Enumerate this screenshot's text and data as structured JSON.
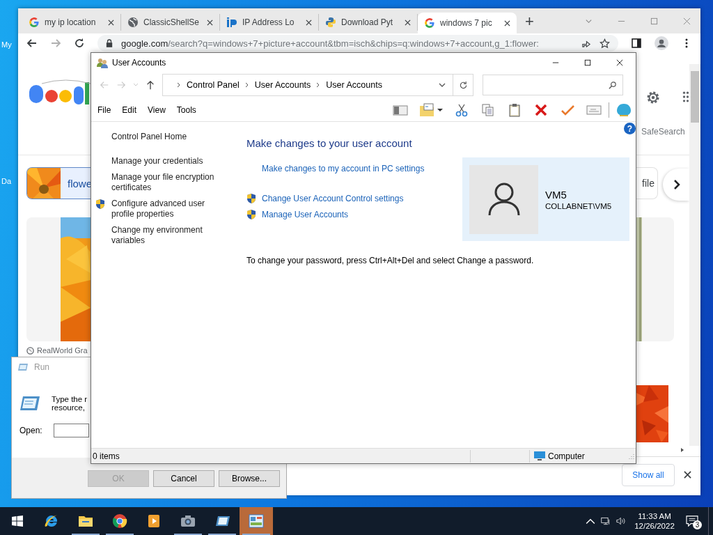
{
  "desktop": {
    "icon_labels": [
      "My",
      "Da"
    ]
  },
  "browser": {
    "tabs": [
      {
        "title": "my ip location",
        "selected": false
      },
      {
        "title": "ClassicShellSe",
        "selected": false
      },
      {
        "title": "IP Address Lo",
        "selected": false
      },
      {
        "title": "Download Pyt",
        "selected": false
      },
      {
        "title": "windows 7 pic",
        "selected": true
      }
    ],
    "new_tab": "+",
    "url_host": "google.com",
    "url_path": "/search?q=windows+7+picture+account&tbm=isch&chips=q:windows+7+account,g_1:flower:",
    "chip_left": "flowe",
    "chip_right": "file",
    "safesearch": "SafeSearch",
    "image_caption": "RealWorld Gra",
    "show_all": "Show all"
  },
  "run_dialog": {
    "title": "Run",
    "description_lines": [
      "Type the r",
      "resource,"
    ],
    "open_label": "Open:",
    "buttons": [
      {
        "label": "OK",
        "disabled": true
      },
      {
        "label": "Cancel",
        "disabled": false
      },
      {
        "label": "Browse...",
        "disabled": false
      }
    ]
  },
  "user_accounts": {
    "title": "User Accounts",
    "breadcrumb": [
      "Control Panel",
      "User Accounts",
      "User Accounts"
    ],
    "menu": [
      "File",
      "Edit",
      "View",
      "Tools"
    ],
    "help": "?",
    "sidebar": [
      {
        "label": "Control Panel Home",
        "shield": false
      },
      {
        "label": "Manage your credentials",
        "shield": false
      },
      {
        "label": "Manage your file encryption certificates",
        "shield": false
      },
      {
        "label": "Configure advanced user profile properties",
        "shield": true
      },
      {
        "label": "Change my environment variables",
        "shield": false
      }
    ],
    "heading": "Make changes to your user account",
    "links": [
      {
        "label": "Make changes to my account in PC settings",
        "shield": false
      },
      {
        "label": "Change User Account Control settings",
        "shield": true
      },
      {
        "label": "Manage User Accounts",
        "shield": true
      }
    ],
    "account": {
      "name": "VM5",
      "domain": "COLLABNET\\VM5"
    },
    "password_note": "To change your password, press Ctrl+Alt+Del and select Change a password.",
    "status": {
      "items": "0 items",
      "location": "Computer"
    }
  },
  "taskbar": {
    "apps": [
      {
        "kind": "ie",
        "running": false,
        "selected": false
      },
      {
        "kind": "folder",
        "running": true,
        "selected": false
      },
      {
        "kind": "chrome",
        "running": true,
        "selected": false
      },
      {
        "kind": "media",
        "running": false,
        "selected": false
      },
      {
        "kind": "camera",
        "running": true,
        "selected": false
      },
      {
        "kind": "run",
        "running": true,
        "selected": false
      },
      {
        "kind": "controlpanel",
        "running": true,
        "selected": true
      }
    ],
    "time": "11:33 AM",
    "date": "12/26/2022",
    "notifications": "3"
  }
}
